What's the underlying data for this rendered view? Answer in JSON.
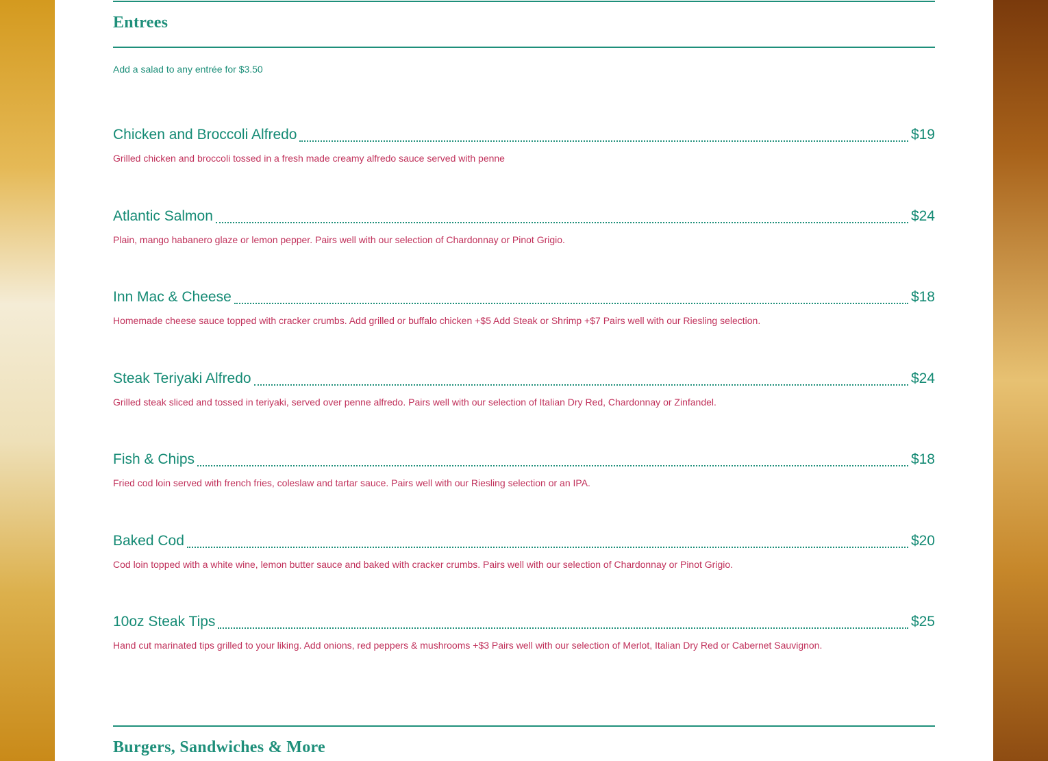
{
  "section_entrees": {
    "title": "Entrees",
    "note": "Add a salad to any entrée for $3.50",
    "items": [
      {
        "name": "Chicken and Broccoli Alfredo",
        "price": "$19",
        "description": "Grilled chicken and broccoli tossed in a fresh made creamy alfredo sauce served with penne"
      },
      {
        "name": "Atlantic Salmon",
        "price": "$24",
        "description": "Plain, mango habanero glaze or lemon pepper. Pairs well with our selection of Chardonnay or Pinot Grigio."
      },
      {
        "name": "Inn Mac & Cheese",
        "price": "$18",
        "description": "Homemade cheese sauce topped with cracker crumbs. Add grilled or buffalo chicken +$5 Add Steak or Shrimp +$7 Pairs well with our Riesling selection."
      },
      {
        "name": "Steak Teriyaki Alfredo",
        "price": "$24",
        "description": "Grilled steak sliced and tossed in teriyaki, served over penne alfredo. Pairs well with our selection of Italian Dry Red, Chardonnay or Zinfandel."
      },
      {
        "name": "Fish & Chips",
        "price": "$18",
        "description": "Fried cod loin served with french fries, coleslaw and tartar sauce. Pairs well with our Riesling selection or an IPA."
      },
      {
        "name": "Baked Cod",
        "price": "$20",
        "description": "Cod loin topped with a white wine, lemon butter sauce and baked with cracker crumbs. Pairs well with our selection of Chardonnay or Pinot Grigio."
      },
      {
        "name": "10oz Steak Tips",
        "price": "$25",
        "description": "Hand cut marinated tips grilled to your liking. Add onions, red peppers & mushrooms +$3 Pairs well with our selection of Merlot, Italian Dry Red or Cabernet Sauvignon."
      }
    ]
  },
  "section_burgers": {
    "title": "Burgers, Sandwiches & More"
  },
  "colors": {
    "accent": "#1e8f7a",
    "description": "#c0305a",
    "panel": "#ffffff"
  }
}
